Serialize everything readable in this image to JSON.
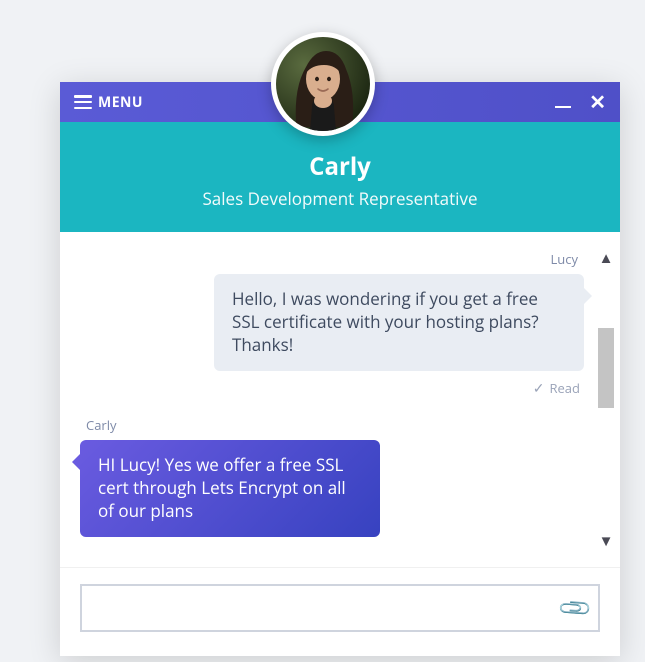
{
  "menu_label": "MENU",
  "agent": {
    "name": "Carly",
    "role": "Sales Development Representative"
  },
  "messages": {
    "user": {
      "sender": "Lucy",
      "text": "Hello, I was wondering if you get a free SSL certificate with your hosting plans? Thanks!",
      "status": "Read"
    },
    "agent": {
      "sender": "Carly",
      "text": "HI Lucy! Yes we offer a free SSL cert through Lets Encrypt on all of our plans"
    }
  },
  "input": {
    "placeholder": ""
  }
}
